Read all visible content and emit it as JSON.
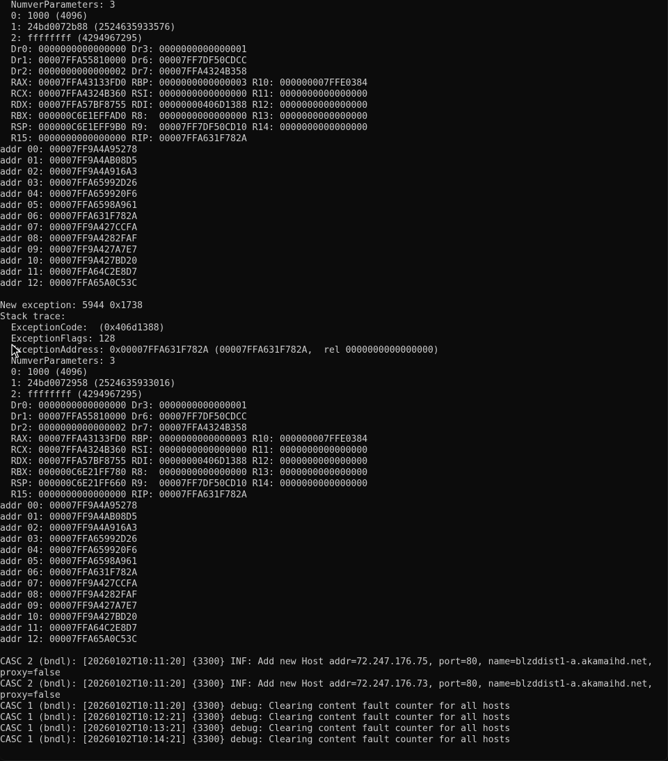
{
  "console": {
    "lines": [
      "  NumverParameters: 3",
      "  0: 1000 (4096)",
      "  1: 24bd0072b88 (2524635933576)",
      "  2: ffffffff (4294967295)",
      "  Dr0: 0000000000000000 Dr3: 0000000000000001",
      "  Dr1: 00007FFA55810000 Dr6: 00007FF7DF50CDCC",
      "  Dr2: 0000000000000002 Dr7: 00007FFA4324B358",
      "  RAX: 00007FFA43133FD0 RBP: 0000000000000003 R10: 000000007FFE0384",
      "  RCX: 00007FFA4324B360 RSI: 0000000000000000 R11: 0000000000000000",
      "  RDX: 00007FFA57BF8755 RDI: 00000000406D1388 R12: 0000000000000000",
      "  RBX: 000000C6E1EFFAD0 R8:  0000000000000000 R13: 0000000000000000",
      "  RSP: 000000C6E1EFF9B0 R9:  00007FF7DF50CD10 R14: 0000000000000000",
      "  R15: 0000000000000000 RIP: 00007FFA631F782A",
      "addr 00: 00007FF9A4A95278",
      "addr 01: 00007FF9A4AB08D5",
      "addr 02: 00007FF9A4A916A3",
      "addr 03: 00007FFA65992D26",
      "addr 04: 00007FFA659920F6",
      "addr 05: 00007FFA6598A961",
      "addr 06: 00007FFA631F782A",
      "addr 07: 00007FF9A427CCFA",
      "addr 08: 00007FF9A4282FAF",
      "addr 09: 00007FF9A427A7E7",
      "addr 10: 00007FF9A427BD20",
      "addr 11: 00007FFA64C2E8D7",
      "addr 12: 00007FFA65A0C53C",
      "",
      "New exception: 5944 0x1738",
      "Stack trace:",
      "  ExceptionCode:  (0x406d1388)",
      "  ExceptionFlags: 128",
      "  ExceptionAddress: 0x00007FFA631F782A (00007FFA631F782A,  rel 0000000000000000)",
      "  NumverParameters: 3",
      "  0: 1000 (4096)",
      "  1: 24bd0072958 (2524635933016)",
      "  2: ffffffff (4294967295)",
      "  Dr0: 0000000000000000 Dr3: 0000000000000001",
      "  Dr1: 00007FFA55810000 Dr6: 00007FF7DF50CDCC",
      "  Dr2: 0000000000000002 Dr7: 00007FFA4324B358",
      "  RAX: 00007FFA43133FD0 RBP: 0000000000000003 R10: 000000007FFE0384",
      "  RCX: 00007FFA4324B360 RSI: 0000000000000000 R11: 0000000000000000",
      "  RDX: 00007FFA57BF8755 RDI: 00000000406D1388 R12: 0000000000000000",
      "  RBX: 000000C6E21FF780 R8:  0000000000000000 R13: 0000000000000000",
      "  RSP: 000000C6E21FF660 R9:  00007FF7DF50CD10 R14: 0000000000000000",
      "  R15: 0000000000000000 RIP: 00007FFA631F782A",
      "addr 00: 00007FF9A4A95278",
      "addr 01: 00007FF9A4AB08D5",
      "addr 02: 00007FF9A4A916A3",
      "addr 03: 00007FFA65992D26",
      "addr 04: 00007FFA659920F6",
      "addr 05: 00007FFA6598A961",
      "addr 06: 00007FFA631F782A",
      "addr 07: 00007FF9A427CCFA",
      "addr 08: 00007FF9A4282FAF",
      "addr 09: 00007FF9A427A7E7",
      "addr 10: 00007FF9A427BD20",
      "addr 11: 00007FFA64C2E8D7",
      "addr 12: 00007FFA65A0C53C",
      "",
      "CASC 2 (bndl): [20260102T10:11:20] {3300} INF: Add new Host addr=72.247.176.75, port=80, name=blzddist1-a.akamaihd.net,",
      "proxy=false",
      "CASC 2 (bndl): [20260102T10:11:20] {3300} INF: Add new Host addr=72.247.176.73, port=80, name=blzddist1-a.akamaihd.net,",
      "proxy=false",
      "CASC 1 (bndl): [20260102T10:11:20] {3300} debug: Clearing content fault counter for all hosts",
      "CASC 1 (bndl): [20260102T10:12:21] {3300} debug: Clearing content fault counter for all hosts",
      "CASC 1 (bndl): [20260102T10:13:21] {3300} debug: Clearing content fault counter for all hosts",
      "CASC 1 (bndl): [20260102T10:14:21] {3300} debug: Clearing content fault counter for all hosts"
    ],
    "cursor_icon": "mouse-pointer-icon",
    "colors": {
      "background": "#0c0c0c",
      "text": "#cccccc"
    }
  }
}
